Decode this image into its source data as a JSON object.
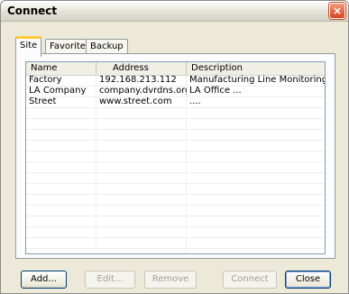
{
  "window": {
    "title": "Connect",
    "close_label": "×"
  },
  "tabs": [
    {
      "label": "Site",
      "active": true
    },
    {
      "label": "Favorite",
      "active": false
    },
    {
      "label": "Backup",
      "active": false
    }
  ],
  "list": {
    "columns": [
      "Name",
      "Address",
      "Description"
    ],
    "rows": [
      [
        "Factory",
        "192.168.213.112",
        "Manufacturing Line Monitoring"
      ],
      [
        "LA Company",
        "company.dvrdns.org",
        "LA Office ..."
      ],
      [
        "Street",
        "www.street.com",
        "...."
      ]
    ]
  },
  "buttons": {
    "add": "Add...",
    "edit": "Edit...",
    "remove": "Remove",
    "connect": "Connect",
    "close": "Close"
  }
}
